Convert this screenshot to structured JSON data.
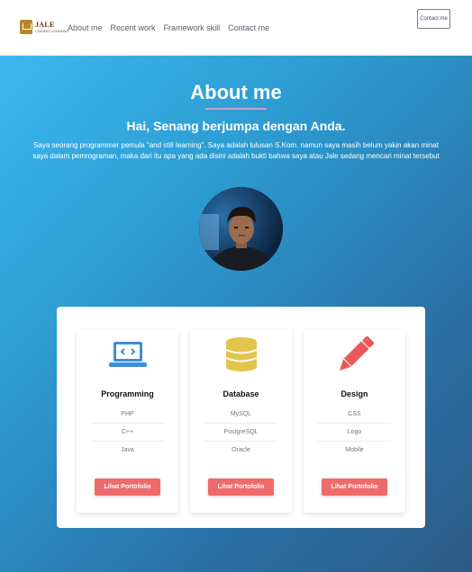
{
  "brand": {
    "title": "JALE",
    "subtitle": "CODING LEARNING"
  },
  "nav": {
    "links": [
      "About me",
      "Recent work",
      "Framework skill",
      "Contact me"
    ],
    "contact_button": "Contact me"
  },
  "about": {
    "title": "About me",
    "subtitle": "Hai, Senang berjumpa dengan Anda.",
    "description": "Saya seorang programmer pemula \"and still learning\". Saya adalah lulusan S.Kom. namun saya masih belum yakin akan minat saya dalam pemrograman, maka dari itu apa yang ada disini adalah bukti bahwa saya atau Jale sedang mencari minat tersebut"
  },
  "skills": [
    {
      "icon": "laptop-code-icon",
      "title": "Programming",
      "items": [
        "PHP",
        "C++",
        "Java"
      ],
      "button": "Lihat Portofolio"
    },
    {
      "icon": "database-icon",
      "title": "Database",
      "items": [
        "MySQL",
        "PostgreSQL",
        "Oracle"
      ],
      "button": "Lihat Portofolio"
    },
    {
      "icon": "pencil-icon",
      "title": "Design",
      "items": [
        "CSS",
        "Logo",
        "Mobile"
      ],
      "button": "Lihat Portofolio"
    }
  ],
  "colors": {
    "accent_button": "#ef6b6b",
    "icon_blue": "#3a8edb",
    "icon_yellow": "#e3c54c",
    "icon_red": "#ea5a5a",
    "hero_gradient_start": "#3bb8f0",
    "hero_gradient_end": "#2c5a85"
  }
}
